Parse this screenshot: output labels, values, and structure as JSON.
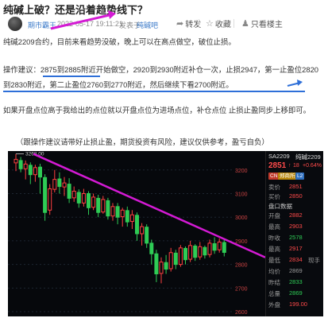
{
  "article": {
    "title": "纯碱上破？还是沿着趋势线下？",
    "author": "期市霸王",
    "date": "2022-05-17 19:11:21",
    "via_label": "发表于",
    "via_source": "纯碱吧"
  },
  "actions": {
    "share": "转发",
    "favorite": "收藏",
    "author_only": "只看楼主"
  },
  "icons": {
    "share": "share-icon",
    "favorite": "star-icon",
    "author_only": "person-icon"
  },
  "body": {
    "p1": "纯碱2209合约，目前来看趋势没破，晚上可以在高点做空，破位止损。",
    "p2": "操作建议：2875到2885附近开始做空，2920到2930附近补仓一次，止损2947，第一止盈位2820到2830附近，第二止盈位2760到2770附近，然后继续下看2700附近。",
    "p3": "如果开盘点位高于我给出的点位就以开盘点位为进场点位，补仓点位 止损止盈同步上移即可。",
    "p4": "（跟操作建议请带好止损止盈，期货投资有风险，建议仅供参考，盈亏自负）"
  },
  "chart": {
    "y_ticks": [
      "3200",
      "3100",
      "3000",
      "2900",
      "2800",
      "2700",
      "2600"
    ],
    "high_label": "3268.00",
    "annotation_color": "#d41ad4"
  },
  "stock_panel": {
    "symbol": "SA2209",
    "name": "纯碱2209",
    "price": "2851",
    "change": "18",
    "change_pct": "+0.64%",
    "tags": [
      "CN",
      "郑商所",
      "L2"
    ],
    "sell_label": "卖价",
    "sell_value": "2851",
    "buy_label": "买价",
    "buy_value": "2850",
    "section": "盘口数据",
    "rows": [
      {
        "label": "开盘",
        "value": "2882",
        "extra": ""
      },
      {
        "label": "最高",
        "value": "2903",
        "extra": ""
      },
      {
        "label": "昨收",
        "value": "2578",
        "extra": ""
      },
      {
        "label": "最高",
        "value": "2917",
        "extra": ""
      },
      {
        "label": "最低",
        "value": "2834",
        "extra": "现手"
      },
      {
        "label": "均价",
        "value": "2869",
        "extra": ""
      },
      {
        "label": "昨结",
        "value": "2833",
        "extra": ""
      },
      {
        "label": "总量",
        "value": "2869",
        "extra": ""
      },
      {
        "label": "外盘",
        "value": "199.00",
        "extra": ""
      }
    ]
  }
}
